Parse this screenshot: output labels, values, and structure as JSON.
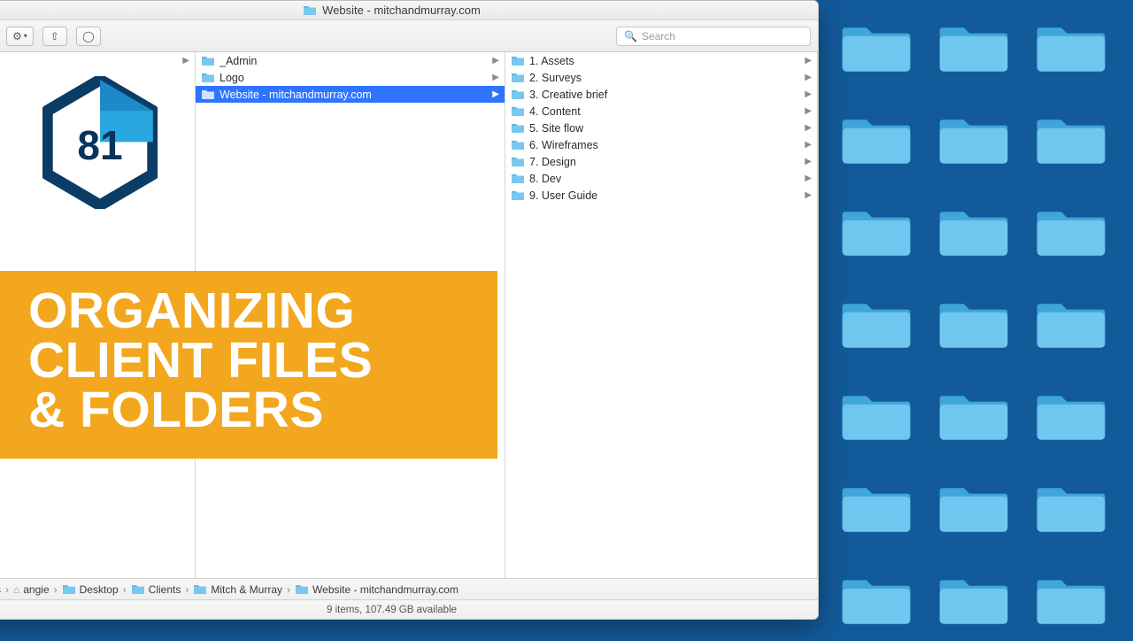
{
  "colors": {
    "background": "#135a9a",
    "accent_orange": "#f2a71e",
    "folder_light": "#6fc6ef",
    "folder_dark": "#3fa6d9",
    "selection": "#2e74ff"
  },
  "finder": {
    "title": "Website - mitchandmurray.com",
    "search_placeholder": "Search",
    "columns": [
      {
        "items": []
      },
      {
        "items": [
          {
            "label": "_Admin",
            "icon": "folder",
            "selected": false
          },
          {
            "label": "Logo",
            "icon": "folder",
            "selected": false
          },
          {
            "label": "Website - mitchandmurray.com",
            "icon": "folder",
            "selected": true
          }
        ]
      },
      {
        "items": [
          {
            "label": "1. Assets",
            "icon": "folder"
          },
          {
            "label": "2. Surveys",
            "icon": "folder"
          },
          {
            "label": "3. Creative brief",
            "icon": "folder"
          },
          {
            "label": "4. Content",
            "icon": "folder"
          },
          {
            "label": "5. Site flow",
            "icon": "folder"
          },
          {
            "label": "6. Wireframes",
            "icon": "folder"
          },
          {
            "label": "7. Design",
            "icon": "folder"
          },
          {
            "label": "8. Dev",
            "icon": "folder"
          },
          {
            "label": "9. User Guide",
            "icon": "folder"
          }
        ]
      }
    ],
    "path": [
      {
        "label": "rs",
        "icon": "folder"
      },
      {
        "label": "angie",
        "icon": "home"
      },
      {
        "label": "Desktop",
        "icon": "folder"
      },
      {
        "label": "Clients",
        "icon": "folder"
      },
      {
        "label": "Mitch & Murray",
        "icon": "folder"
      },
      {
        "label": "Website - mitchandmurray.com",
        "icon": "folder"
      }
    ],
    "status": "9 items, 107.49 GB available"
  },
  "badge": {
    "number": "81"
  },
  "banner": {
    "line1": "ORGANIZING",
    "line2": "CLIENT FILES",
    "line3": "& FOLDERS"
  }
}
